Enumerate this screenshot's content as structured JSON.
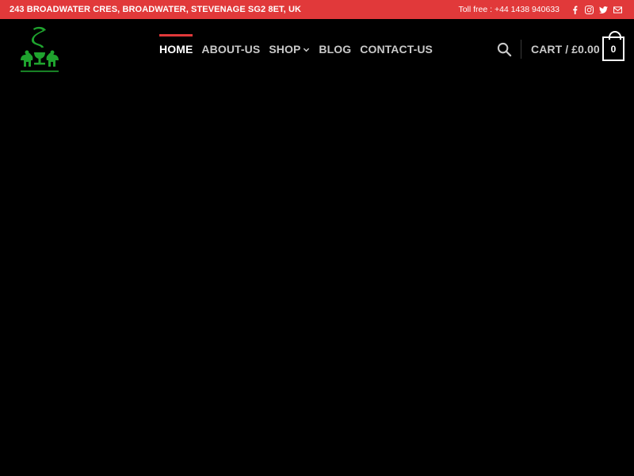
{
  "topbar": {
    "address": "243 BROADWATER CRES, BROADWATER, STEVENAGE SG2 8ET, UK",
    "toll_free": "Toll free : +44 1438 940633",
    "social_icons": [
      "facebook-icon",
      "instagram-icon",
      "twitter-icon",
      "envelope-icon"
    ],
    "background_color": "#e1393a"
  },
  "header": {
    "logo_icon": "pharmacy-logo",
    "logo_color": "#1fa32e",
    "nav": [
      {
        "label": "HOME",
        "active": true
      },
      {
        "label": "ABOUT-US",
        "active": false
      },
      {
        "label": "SHOP",
        "active": false,
        "has_dropdown": true
      },
      {
        "label": "BLOG",
        "active": false
      },
      {
        "label": "CONTACT-US",
        "active": false
      }
    ],
    "search_icon": "search-icon",
    "cart_label": "CART / £0.00",
    "cart_count": "0",
    "accent_color": "#e1393a"
  }
}
